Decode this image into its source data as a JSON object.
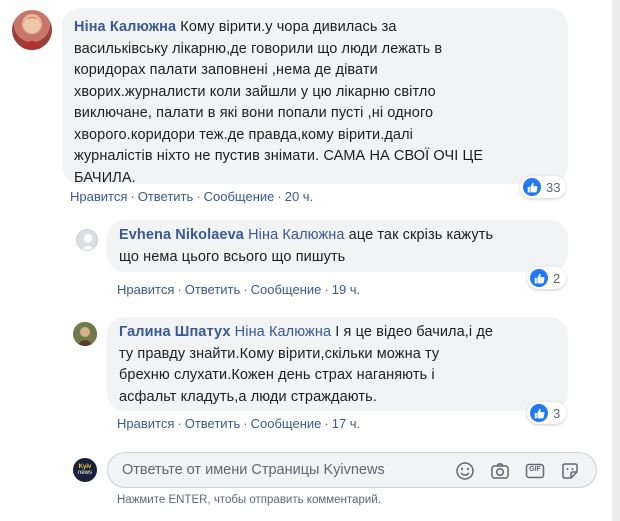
{
  "comments": [
    {
      "author": "Ніна Калюжна",
      "mention": "",
      "lines": [
        "Кому вірити.у чора дивилась за",
        "васильківську лікарню,де говорили що люди лежать в",
        "коридорах палати заповнені ,нема де дівати",
        "хворих.журналисти коли зайшли у цю лікарню світло",
        "виключане, палати в які вони попали пусті ,ні одного",
        "хворого.коридори теж.де правда,кому вірити.далі",
        "журналістів ніхто не пустив знімати. САМА НА СВОЇ ОЧІ ЦЕ",
        "БАЧИЛА."
      ],
      "like": "Нравится",
      "reply": "Ответить",
      "message": "Сообщение",
      "time": "20 ч.",
      "reactions": "33"
    },
    {
      "author": "Evhena Nikolaeva",
      "mention": "Ніна Калюжна",
      "lines": [
        "аце так скрізь кажуть",
        "що нема цього всього що пишуть"
      ],
      "like": "Нравится",
      "reply": "Ответить",
      "message": "Сообщение",
      "time": "19 ч.",
      "reactions": "2"
    },
    {
      "author": "Галина Шпатух",
      "mention": "Ніна Калюжна",
      "lines": [
        "І я це відео бачила,і де",
        "ту правду знайти.Кому вірити,скільки можна ту",
        "брехню слухати.Кожен день страх наганяють і",
        "асфальт кладуть,а люди страждають."
      ],
      "like": "Нравится",
      "reply": "Ответить",
      "message": "Сообщение",
      "time": "17 ч.",
      "reactions": "3"
    }
  ],
  "composer": {
    "avatar_text_top": "Kyiv",
    "avatar_text_bottom": "news",
    "placeholder": "Ответьте от имени Страницы Kyivnews",
    "tools": [
      "emoji-icon",
      "camera-icon",
      "gif-icon",
      "sticker-icon"
    ],
    "gif_label": "GIF",
    "hint": "Нажмите ENTER, чтобы отправить комментарий."
  },
  "colors": {
    "link": "#385898",
    "bubble": "#f2f3f5",
    "like_blue": "#2078f4"
  }
}
